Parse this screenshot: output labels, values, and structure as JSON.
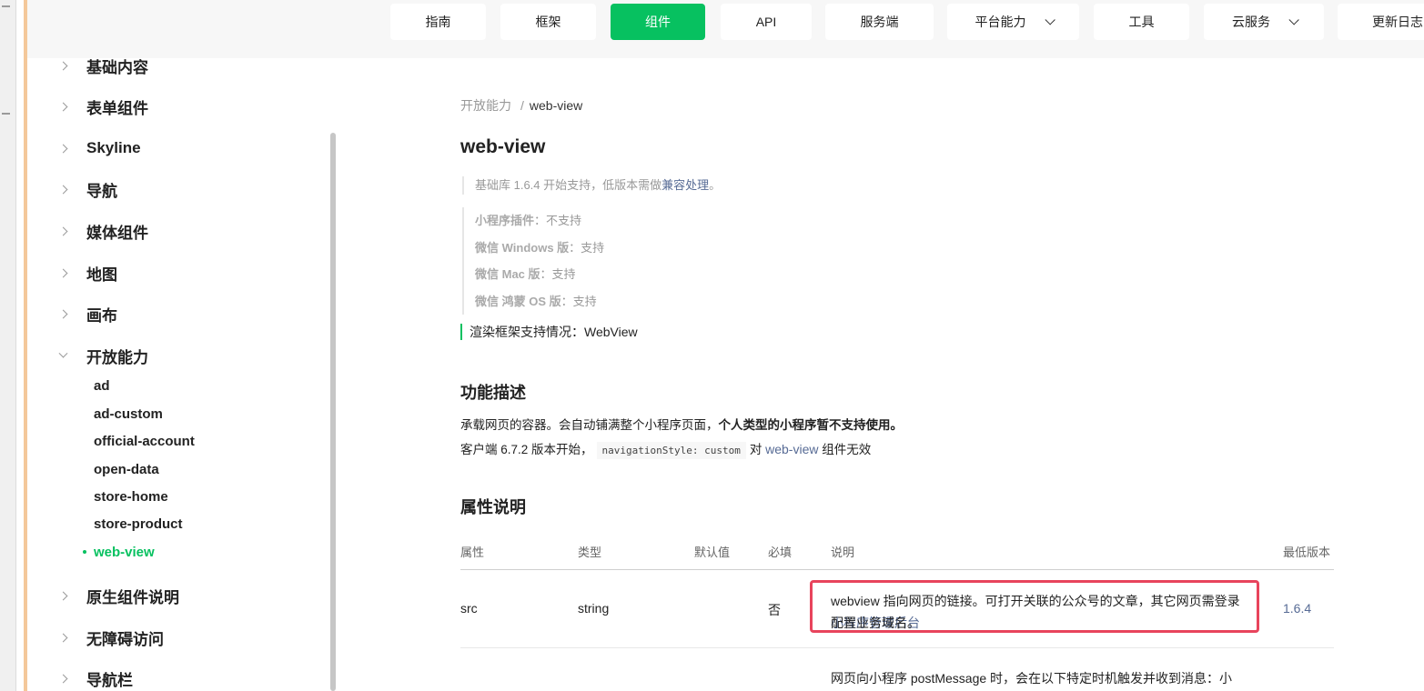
{
  "nav": {
    "items": [
      {
        "label": "指南",
        "active": false,
        "dropdown": false
      },
      {
        "label": "框架",
        "active": false,
        "dropdown": false
      },
      {
        "label": "组件",
        "active": true,
        "dropdown": false
      },
      {
        "label": "API",
        "active": false,
        "dropdown": false
      },
      {
        "label": "服务端",
        "active": false,
        "dropdown": false
      },
      {
        "label": "平台能力",
        "active": false,
        "dropdown": true
      },
      {
        "label": "工具",
        "active": false,
        "dropdown": false
      },
      {
        "label": "云服务",
        "active": false,
        "dropdown": true
      },
      {
        "label": "更新日志",
        "active": false,
        "dropdown": false
      }
    ]
  },
  "sidebar": {
    "items": [
      {
        "label": "基础内容"
      },
      {
        "label": "表单组件"
      },
      {
        "label": "Skyline"
      },
      {
        "label": "导航"
      },
      {
        "label": "媒体组件"
      },
      {
        "label": "地图"
      },
      {
        "label": "画布"
      },
      {
        "label": "开放能力",
        "open": true
      },
      {
        "label": "原生组件说明"
      },
      {
        "label": "无障碍访问"
      },
      {
        "label": "导航栏"
      }
    ],
    "sub_items": [
      {
        "label": "ad"
      },
      {
        "label": "ad-custom"
      },
      {
        "label": "official-account"
      },
      {
        "label": "open-data"
      },
      {
        "label": "store-home"
      },
      {
        "label": "store-product"
      },
      {
        "label": "web-view",
        "active": true
      }
    ]
  },
  "content": {
    "breadcrumb": {
      "parent": "开放能力",
      "separator": "/",
      "current": "web-view"
    },
    "title": "web-view",
    "support_note": {
      "prefix": "基础库 1.6.4 开始支持，低版本需做",
      "link": "兼容处理",
      "suffix": "。"
    },
    "platforms": [
      {
        "name": "小程序插件",
        "value": "：不支持"
      },
      {
        "name": "微信 Windows 版",
        "value": "：支持"
      },
      {
        "name": "微信 Mac 版",
        "value": "：支持"
      },
      {
        "name": "微信 鸿蒙 OS 版",
        "value": "：支持"
      }
    ],
    "render_note": "渲染框架支持情况：WebView",
    "section_desc": {
      "title": "功能描述",
      "p1_normal": "承载网页的容器。会自动铺满整个小程序页面，",
      "p1_bold": "个人类型的小程序暂不支持使用。",
      "p2_prefix": "客户端 6.7.2 版本开始，",
      "p2_code": "navigationStyle: custom",
      "p2_mid": "对 ",
      "p2_link": "web-view",
      "p2_suffix": " 组件无效"
    },
    "section_props": {
      "title": "属性说明"
    },
    "table": {
      "headers": {
        "attr": "属性",
        "type": "类型",
        "default": "默认值",
        "required": "必填",
        "desc": "说明",
        "min_version": "最低版本"
      },
      "row1": {
        "attr": "src",
        "type": "string",
        "default": "",
        "required": "否",
        "desc_text": "webview 指向网页的链接。可打开关联的公众号的文章，其它网页需登录",
        "desc_link": "小程序管理后台",
        "desc_suffix": "配置业务域名。",
        "min_version": "1.6.4"
      },
      "row2_desc": "网页向小程序 postMessage 时，会在以下特定时机触发并收到消息：小"
    }
  },
  "colors": {
    "accent": "#07c160",
    "link": "#576b95",
    "highlight": "#e8445c"
  }
}
